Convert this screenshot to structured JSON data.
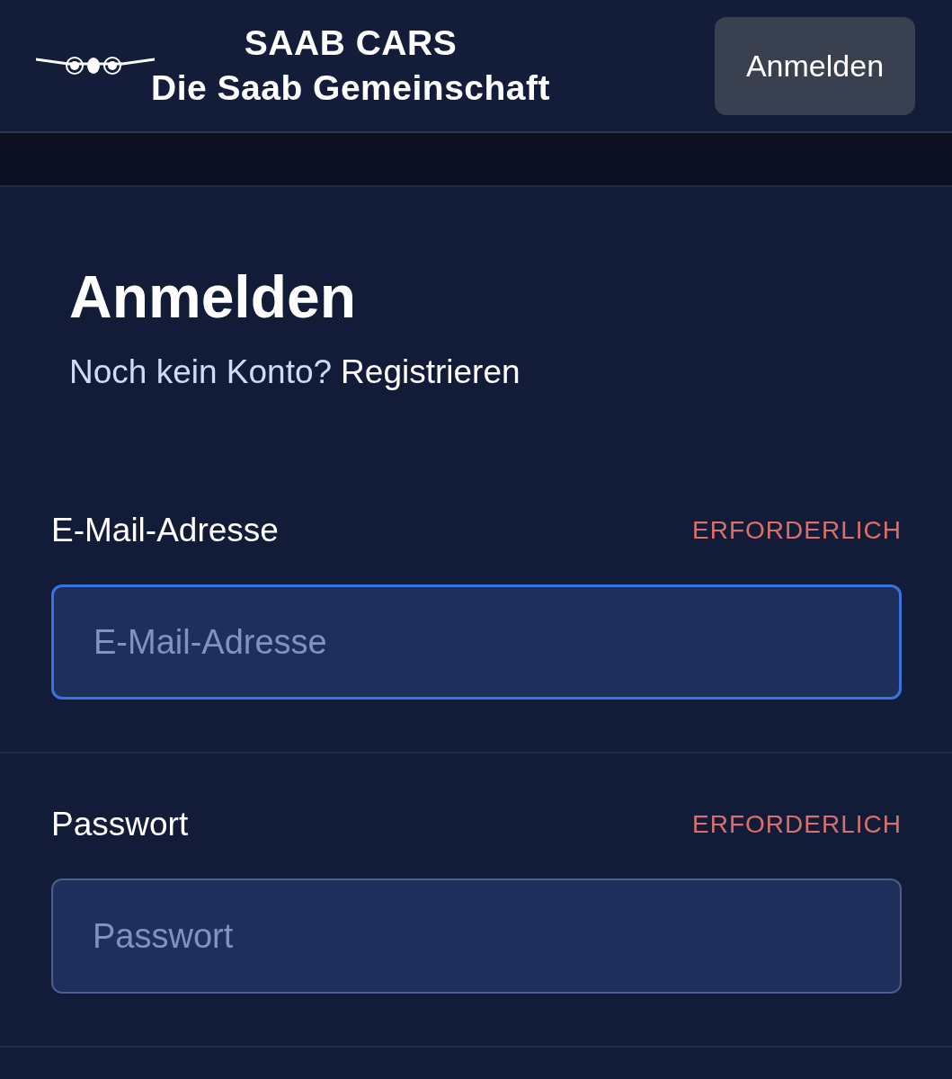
{
  "header": {
    "logo": {
      "title": "SAAB CARS",
      "subtitle": "Die Saab Gemeinschaft"
    },
    "login_button": "Anmelden"
  },
  "form": {
    "title": "Anmelden",
    "prompt": "Noch kein Konto?",
    "register_link": "Registrieren",
    "fields": [
      {
        "label": "E-Mail-Adresse",
        "required": "ERFORDERLICH",
        "placeholder": "E-Mail-Adresse",
        "focused": true
      },
      {
        "label": "Passwort",
        "required": "ERFORDERLICH",
        "placeholder": "Passwort",
        "focused": false
      }
    ]
  }
}
